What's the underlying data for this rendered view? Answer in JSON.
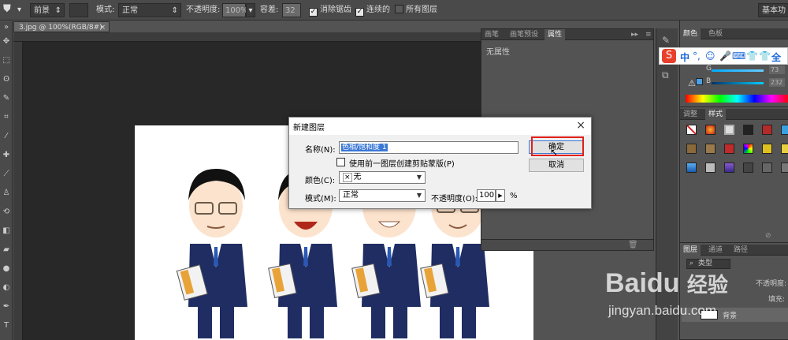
{
  "options_bar": {
    "fill_select": "前景",
    "mode_label": "模式:",
    "mode_value": "正常",
    "opacity_label": "不透明度:",
    "opacity_value": "100%",
    "tolerance_label": "容差:",
    "tolerance_value": "32",
    "antialias_label": "消除锯齿",
    "contiguous_label": "连续的",
    "all_layers_label": "所有图层",
    "workspace_button": "基本功"
  },
  "document": {
    "tab_title": "3.jpg @ 100%(RGB/8#)",
    "tab_close": "×"
  },
  "properties_panel": {
    "tabs": [
      "画笔",
      "画笔预设",
      "属性"
    ],
    "active_tab": "属性",
    "content": "无属性"
  },
  "color_panel": {
    "tabs": [
      "颜色",
      "色板"
    ],
    "channel_labels": [
      "R",
      "G",
      "B"
    ],
    "channel_values": [
      "",
      "73",
      "232"
    ]
  },
  "styles_panel": {
    "tabs": [
      "调整",
      "样式"
    ]
  },
  "layers_panel": {
    "tabs": [
      "图层",
      "通道",
      "路径"
    ],
    "kind_filter": "类型",
    "opacity_label": "不透明度:",
    "fill_label": "填充:",
    "layer_name": "背景"
  },
  "ime_bar": {
    "items": [
      "中",
      "°,",
      "☺",
      "🎤",
      "⌨",
      "👕",
      "👕",
      "全",
      "⚏"
    ]
  },
  "dialog": {
    "title": "新建图层",
    "close": "×",
    "name_label": "名称(N):",
    "name_value": "色相/饱和度 1",
    "clip_label": "使用前一图层创建剪贴蒙版(P)",
    "color_label": "颜色(C):",
    "color_value": "无",
    "color_x": "×",
    "mode_label": "模式(M):",
    "mode_value": "正常",
    "opacity_label": "不透明度(O):",
    "opacity_value": "100",
    "opacity_unit": "%",
    "ok_button": "确定",
    "cancel_button": "取消"
  },
  "watermark": {
    "brand": "Baidu",
    "brand_cn": "经验",
    "url": "jingyan.baidu.com"
  },
  "colors": {
    "highlight_box": "#e0201a",
    "panel_bg": "#535353",
    "canvas_bg": "#282828",
    "suit": "#1f2d63"
  }
}
